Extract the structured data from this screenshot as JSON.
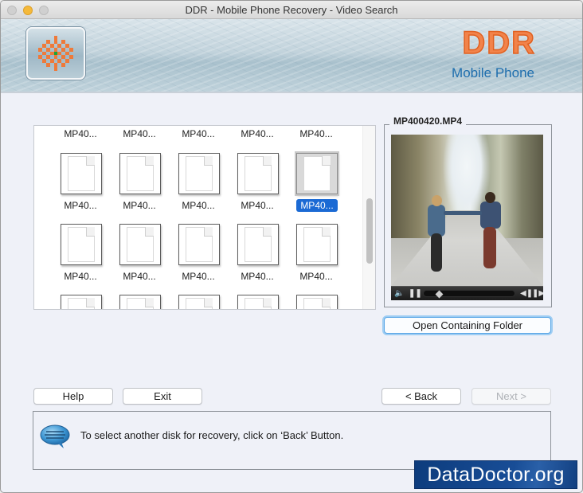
{
  "window": {
    "title": "DDR - Mobile Phone Recovery - Video Search"
  },
  "banner": {
    "brand": "DDR",
    "product": "Mobile Phone",
    "logo_icon": "checkered-starburst-icon"
  },
  "file_grid": {
    "rows": [
      {
        "labels": [
          "MP40...",
          "MP40...",
          "MP40...",
          "MP40...",
          "MP40..."
        ],
        "has_icons": false
      },
      {
        "labels": [
          "MP40...",
          "MP40...",
          "MP40...",
          "MP40...",
          "MP40..."
        ],
        "has_icons": true,
        "selected_index": 4
      },
      {
        "labels": [
          "MP40...",
          "MP40...",
          "MP40...",
          "MP40...",
          "MP40..."
        ],
        "has_icons": true
      },
      {
        "labels": [],
        "has_icons": true,
        "partial": true
      }
    ],
    "file_icon": "blank-document-icon",
    "scroll_position": 0.45
  },
  "preview": {
    "title": "MP400420.MP4",
    "player": {
      "volume_icon": "speaker-icon",
      "pause_icon": "pause-icon",
      "prev_frame_icon": "step-back-icon",
      "next_frame_icon": "step-forward-icon",
      "progress": 0.12
    },
    "open_folder_label": "Open Containing Folder"
  },
  "buttons": {
    "help": "Help",
    "exit": "Exit",
    "back": "< Back",
    "next": "Next >"
  },
  "status": {
    "icon": "speech-bubble-icon",
    "message": "To select another disk for recovery, click on ‘Back’ Button."
  },
  "watermark": "DataDoctor.org",
  "colors": {
    "selection": "#1b6ad4",
    "brand_orange": "#f2834a",
    "brand_blue": "#1e6eae",
    "focus_ring": "#5aa6e6"
  }
}
